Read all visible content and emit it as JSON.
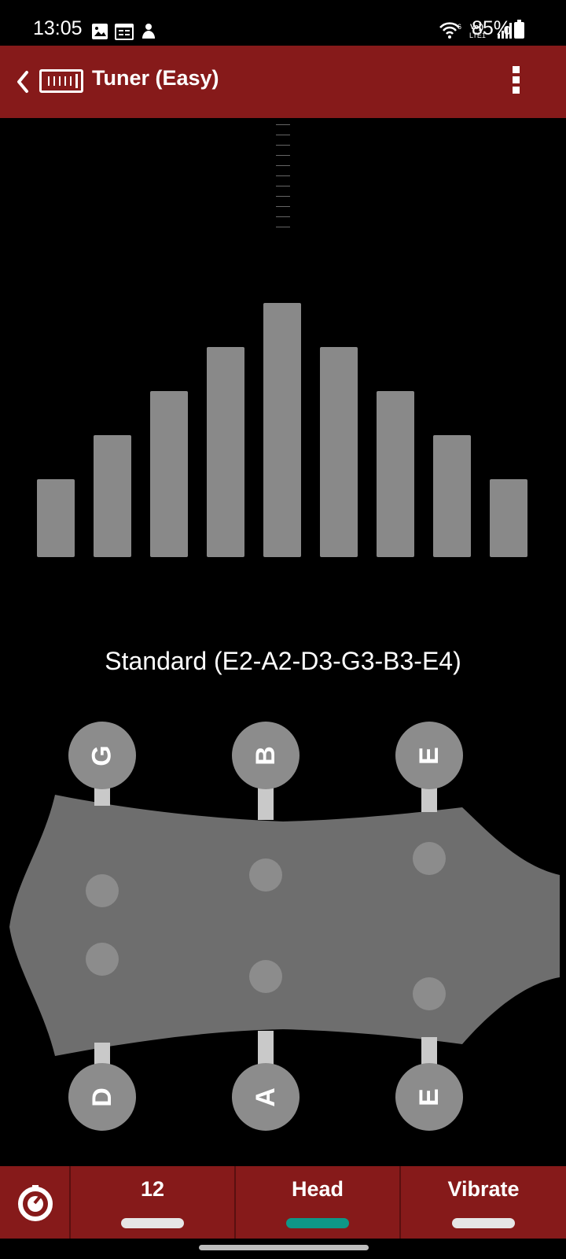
{
  "status_bar": {
    "time": "13:05",
    "battery_percent": "85%",
    "icons": [
      "gallery-icon",
      "calendar-icon",
      "notification-icon",
      "wifi-icon",
      "volte-icon",
      "signal-icon",
      "battery-icon"
    ]
  },
  "toolbar": {
    "title": "Tuner (Easy)",
    "back_icon": "chevron-left-icon",
    "app_icon": "tuner-icon",
    "menu_icon": "more-vert-icon"
  },
  "tuning": {
    "label": "Standard (E2-A2-D3-G3-B3-E4)"
  },
  "pegs": {
    "top": [
      "G",
      "B",
      "E"
    ],
    "bottom": [
      "D",
      "A",
      "E"
    ]
  },
  "bottom_tabs": {
    "settings_icon": "gauge-icon",
    "items": [
      {
        "label": "12",
        "active": false
      },
      {
        "label": "Head",
        "active": true
      },
      {
        "label": "Vibrate",
        "active": false
      }
    ]
  },
  "colors": {
    "toolbar": "#861a1a",
    "bar": "#898989",
    "headstock": "#6e6e6e",
    "peg": "#8c8c8c",
    "active_indicator": "#0e9787"
  },
  "meter": {
    "bar_levels": [
      0.3,
      0.47,
      0.64,
      0.81,
      0.98,
      0.81,
      0.64,
      0.47,
      0.3
    ]
  }
}
